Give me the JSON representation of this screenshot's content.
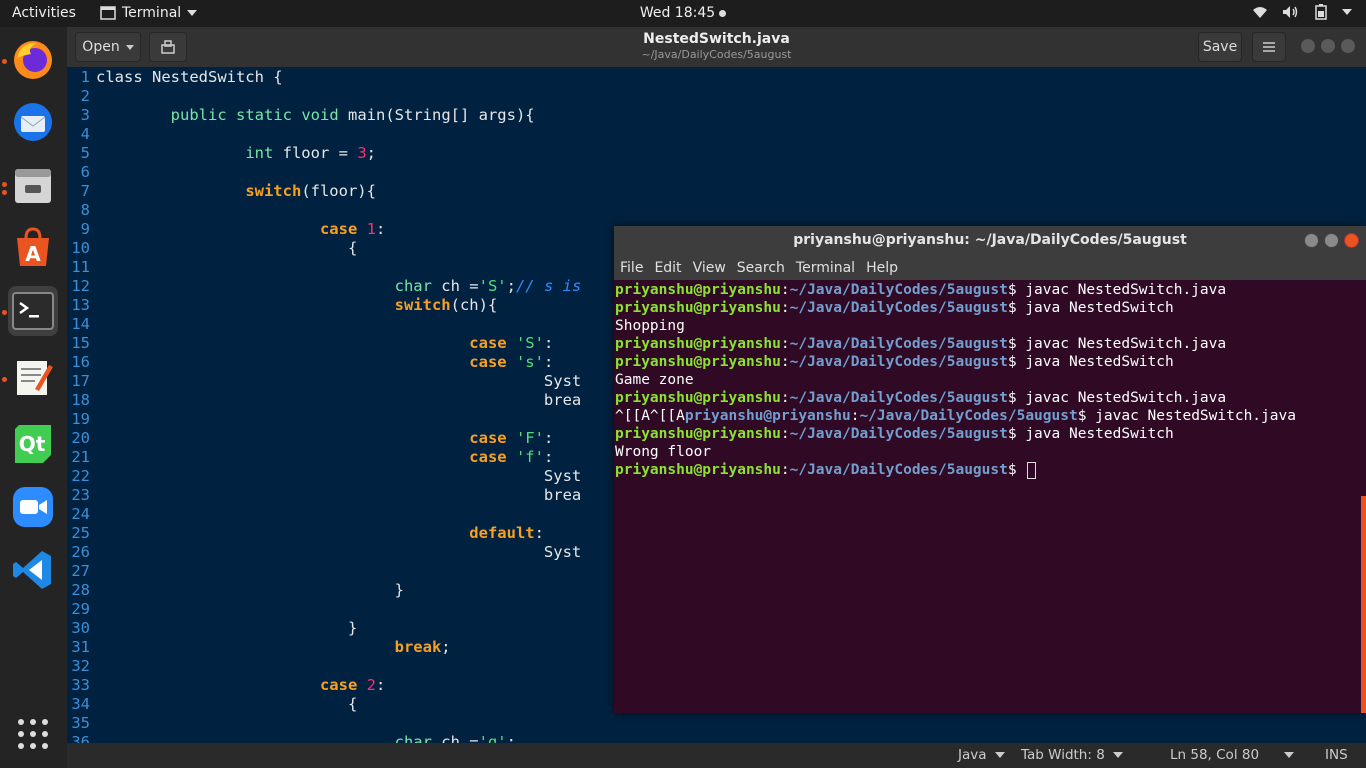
{
  "topbar": {
    "activities": "Activities",
    "app_name": "Terminal",
    "clock": "Wed 18:45"
  },
  "dock": {
    "items": [
      {
        "name": "firefox-icon"
      },
      {
        "name": "thunderbird-icon"
      },
      {
        "name": "files-icon"
      },
      {
        "name": "software-center-icon"
      },
      {
        "name": "terminal-icon"
      },
      {
        "name": "text-editor-icon"
      },
      {
        "name": "qt-creator-icon"
      },
      {
        "name": "zoom-icon"
      },
      {
        "name": "vscode-icon"
      },
      {
        "name": "show-apps-icon"
      }
    ]
  },
  "gedit": {
    "open_label": "Open",
    "title": "NestedSwitch.java",
    "subtitle": "~/Java/DailyCodes/5august",
    "save_label": "Save"
  },
  "editor_lines": [
    {
      "n": "1",
      "t": "class NestedSwitch {"
    },
    {
      "n": "2",
      "t": ""
    },
    {
      "n": "3",
      "t": "\tpublic static void main(String[] args){"
    },
    {
      "n": "4",
      "t": ""
    },
    {
      "n": "5",
      "t": "\t\tint floor = 3;"
    },
    {
      "n": "6",
      "t": ""
    },
    {
      "n": "7",
      "t": "\t\tswitch(floor){"
    },
    {
      "n": "8",
      "t": ""
    },
    {
      "n": "9",
      "t": "\t\t\tcase 1:"
    },
    {
      "n": "10",
      "t": "\t\t\t   {"
    },
    {
      "n": "11",
      "t": ""
    },
    {
      "n": "12",
      "t": "\t\t\t\tchar ch ='S';// s is"
    },
    {
      "n": "13",
      "t": "\t\t\t\tswitch(ch){"
    },
    {
      "n": "14",
      "t": ""
    },
    {
      "n": "15",
      "t": "\t\t\t\t\tcase 'S':"
    },
    {
      "n": "16",
      "t": "\t\t\t\t\tcase 's':"
    },
    {
      "n": "17",
      "t": "\t\t\t\t\t\tSyst"
    },
    {
      "n": "18",
      "t": "\t\t\t\t\t\tbrea"
    },
    {
      "n": "19",
      "t": ""
    },
    {
      "n": "20",
      "t": "\t\t\t\t\tcase 'F':"
    },
    {
      "n": "21",
      "t": "\t\t\t\t\tcase 'f':"
    },
    {
      "n": "22",
      "t": "\t\t\t\t\t\tSyst"
    },
    {
      "n": "23",
      "t": "\t\t\t\t\t\tbrea"
    },
    {
      "n": "24",
      "t": ""
    },
    {
      "n": "25",
      "t": "\t\t\t\t\tdefault:"
    },
    {
      "n": "26",
      "t": "\t\t\t\t\t\tSyst"
    },
    {
      "n": "27",
      "t": ""
    },
    {
      "n": "28",
      "t": "\t\t\t\t}"
    },
    {
      "n": "29",
      "t": ""
    },
    {
      "n": "30",
      "t": "\t\t\t   }"
    },
    {
      "n": "31",
      "t": "\t\t\t\tbreak;"
    },
    {
      "n": "32",
      "t": ""
    },
    {
      "n": "33",
      "t": "\t\t\tcase 2:"
    },
    {
      "n": "34",
      "t": "\t\t\t   {"
    },
    {
      "n": "35",
      "t": ""
    },
    {
      "n": "36",
      "t": "\t\t\t\tchar ch ='g';"
    }
  ],
  "status": {
    "language": "Java",
    "tab_width": "Tab Width: 8",
    "position": "Ln 58, Col 80",
    "mode": "INS"
  },
  "terminal": {
    "title": "priyanshu@priyanshu: ~/Java/DailyCodes/5august",
    "menu": [
      "File",
      "Edit",
      "View",
      "Search",
      "Terminal",
      "Help"
    ],
    "user": "priyanshu@priyanshu",
    "path": "~/Java/DailyCodes/5august",
    "lines": [
      {
        "kind": "prompt",
        "cmd": " javac NestedSwitch.java"
      },
      {
        "kind": "prompt",
        "cmd": " java NestedSwitch"
      },
      {
        "kind": "out",
        "text": "Shopping"
      },
      {
        "kind": "prompt",
        "cmd": " javac NestedSwitch.java"
      },
      {
        "kind": "prompt",
        "cmd": " java NestedSwitch"
      },
      {
        "kind": "out",
        "text": "Game zone"
      },
      {
        "kind": "prompt",
        "cmd": " javac NestedSwitch.java"
      },
      {
        "kind": "prompt",
        "pre": "^[[A^[[A",
        "cmd": " javac NestedSwitch.java"
      },
      {
        "kind": "prompt",
        "cmd": " java NestedSwitch"
      },
      {
        "kind": "out",
        "text": "Wrong floor"
      },
      {
        "kind": "prompt",
        "cmd": " ",
        "cursor": true
      }
    ]
  }
}
